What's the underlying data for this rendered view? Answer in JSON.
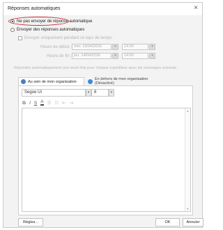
{
  "window": {
    "title": "Réponses automatiques",
    "close_glyph": "×"
  },
  "options": {
    "no_reply": "Ne pas envoyer de réponse automatique",
    "send_reply": "Envoyer des réponses automatiques",
    "time_range_only": "Envoyer uniquement pendant ce laps de temps :",
    "start_label": "Heure de début :",
    "start_date": "mer. 13/04/2016",
    "start_time": "14:00",
    "end_label": "Heure de fin :",
    "end_date": "jeu. 14/04/2016",
    "end_time": "14:00",
    "info_text": "Répondre automatiquement une seule fois pour chaque expéditeur avec les messages suivants :"
  },
  "tabs": {
    "inside": "Au sein de mon organisation",
    "outside": "En dehors de mon organisation (Désactivé)"
  },
  "editor": {
    "font": "Segoe UI",
    "size": "8",
    "bold": "G",
    "italic": "I",
    "underline": "S",
    "font_color": "A"
  },
  "buttons": {
    "rules": "Règles...",
    "ok": "OK",
    "cancel": "Annuler"
  },
  "colors": {
    "highlight_oval": "#d32027",
    "inside_icon": "#4a7fb8",
    "outside_icon": "#3b8ed6"
  }
}
